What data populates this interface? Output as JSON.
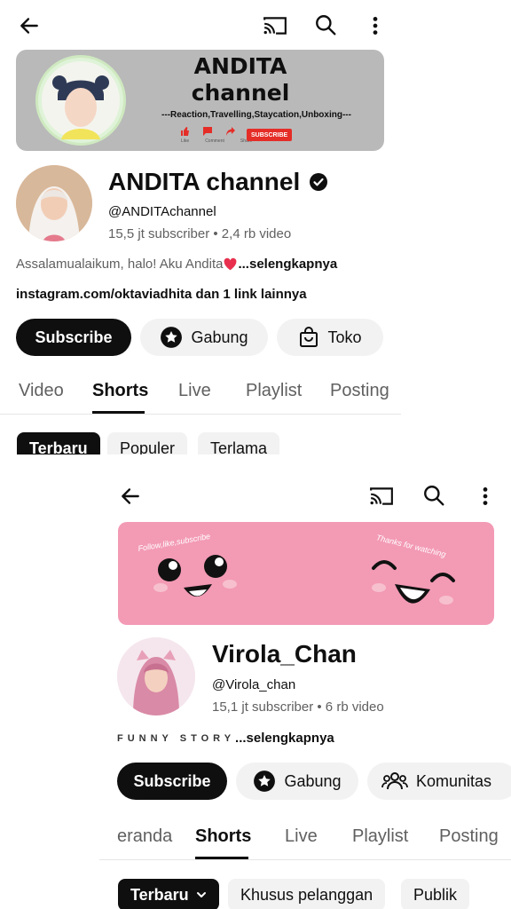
{
  "colors": {
    "dark": "#0f0f0f",
    "chip_light": "#f2f2f2",
    "banner1_bg": "#b7b7b7",
    "banner2_bg": "#f39ab5",
    "subtext": "#606060",
    "verified": "#0f0f0f",
    "heart": "#e8304e"
  },
  "panel1": {
    "top_icons": [
      "back-arrow-icon",
      "cast-icon",
      "search-icon",
      "more-vertical-icon"
    ],
    "banner": {
      "title_line1": "ANDITA",
      "title_line2": "channel",
      "subtitle": "---Reaction,Travelling,Staycation,Unboxing---",
      "subscribe_badge": "SUBSCRIBE",
      "action_labels": [
        "Like",
        "Comment",
        "Share"
      ]
    },
    "channel_name": "ANDITA channel",
    "handle": "@ANDITAchannel",
    "stats": "15,5 jt subscriber • 2,4 rb video",
    "description": "Assalamualaikum, halo! Aku Andita",
    "description_more": " ...selengkapnya",
    "link": "instagram.com/oktaviadhita dan 1 link lainnya",
    "buttons": {
      "subscribe": "Subscribe",
      "join": "Gabung",
      "store": "Toko"
    },
    "tabs": [
      "Video",
      "Shorts",
      "Live",
      "Playlist",
      "Posting"
    ],
    "active_tab": "Shorts",
    "chips": [
      "Terbaru",
      "Populer",
      "Terlama"
    ]
  },
  "panel2": {
    "top_icons": [
      "back-arrow-icon",
      "cast-icon",
      "search-icon",
      "more-vertical-icon"
    ],
    "banner": {
      "left_text": "Follow,like,subscribe",
      "right_text": "Thanks for watching"
    },
    "channel_name": "Virola_Chan",
    "handle": "@Virola_chan",
    "stats": "15,1 jt subscriber • 6 rb video",
    "description": "FUNNY STORY",
    "description_more": " ...selengkapnya",
    "buttons": {
      "subscribe": "Subscribe",
      "join": "Gabung",
      "community": "Komunitas"
    },
    "tabs": [
      "eranda",
      "Shorts",
      "Live",
      "Playlist",
      "Posting"
    ],
    "active_tab": "Shorts",
    "chips": [
      "Terbaru",
      "Khusus pelanggan",
      "Publik"
    ]
  }
}
